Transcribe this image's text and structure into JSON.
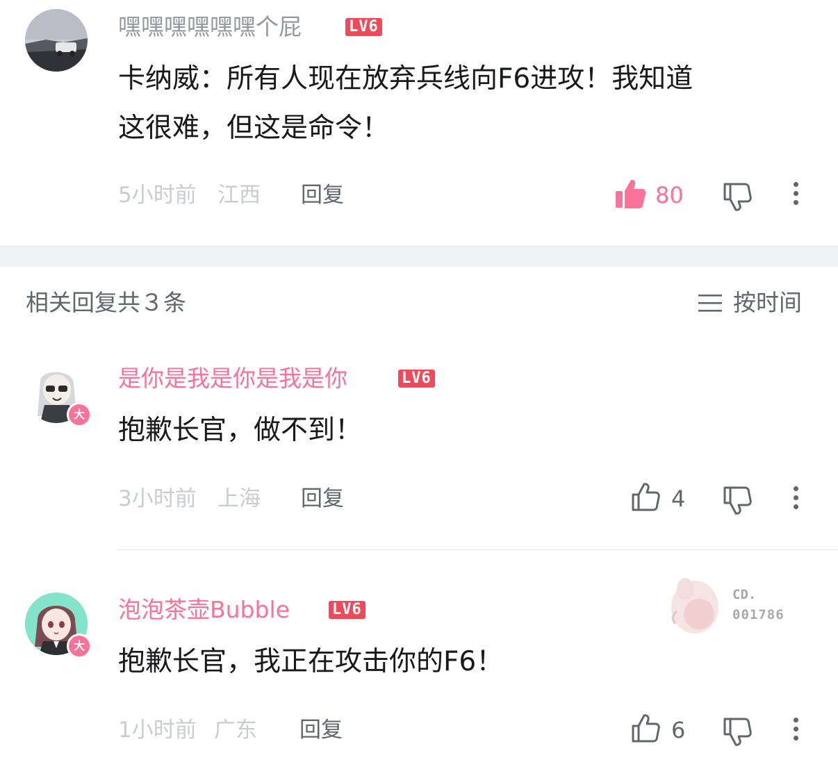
{
  "root_comment": {
    "username": "嘿嘿嘿嘿嘿嘿个屁",
    "level": "LV6",
    "content_lines": [
      "卡纳威：所有人现在放弃兵线向F6进攻！我知道",
      "这很难，但这是命令！"
    ],
    "time": "5小时前",
    "location": "江西",
    "reply_label": "回复",
    "likes": "80",
    "liked": true,
    "icons": {
      "like": "thumbs-up-icon",
      "dislike": "thumbs-down-icon",
      "more": "more-vertical-icon"
    }
  },
  "replies_header": {
    "title": "相关回复共３条",
    "sort_label": "按时间",
    "sort_icon": "menu-lines-icon"
  },
  "replies": [
    {
      "username": "是你是我是你是我是你",
      "level": "LV6",
      "badge": "大",
      "content": "抱歉长官，做不到！",
      "time": "3小时前",
      "location": "上海",
      "reply_label": "回复",
      "likes": "4"
    },
    {
      "username": "泡泡茶壶Bubble",
      "level": "LV6",
      "badge": "大",
      "content": "抱歉长官，我正在攻击你的F6！",
      "time": "1小时前",
      "location": "广东",
      "reply_label": "回复",
      "likes": "6",
      "decoration": {
        "line1": "CD.",
        "line2": "001786"
      }
    }
  ],
  "colors": {
    "accent_pink": "#fb7299",
    "username_gray": "#9499a0",
    "level_red": "#ef4a5a",
    "text": "#18191c",
    "meta": "#c9ccd0",
    "divider_band": "#f1f2f3"
  }
}
